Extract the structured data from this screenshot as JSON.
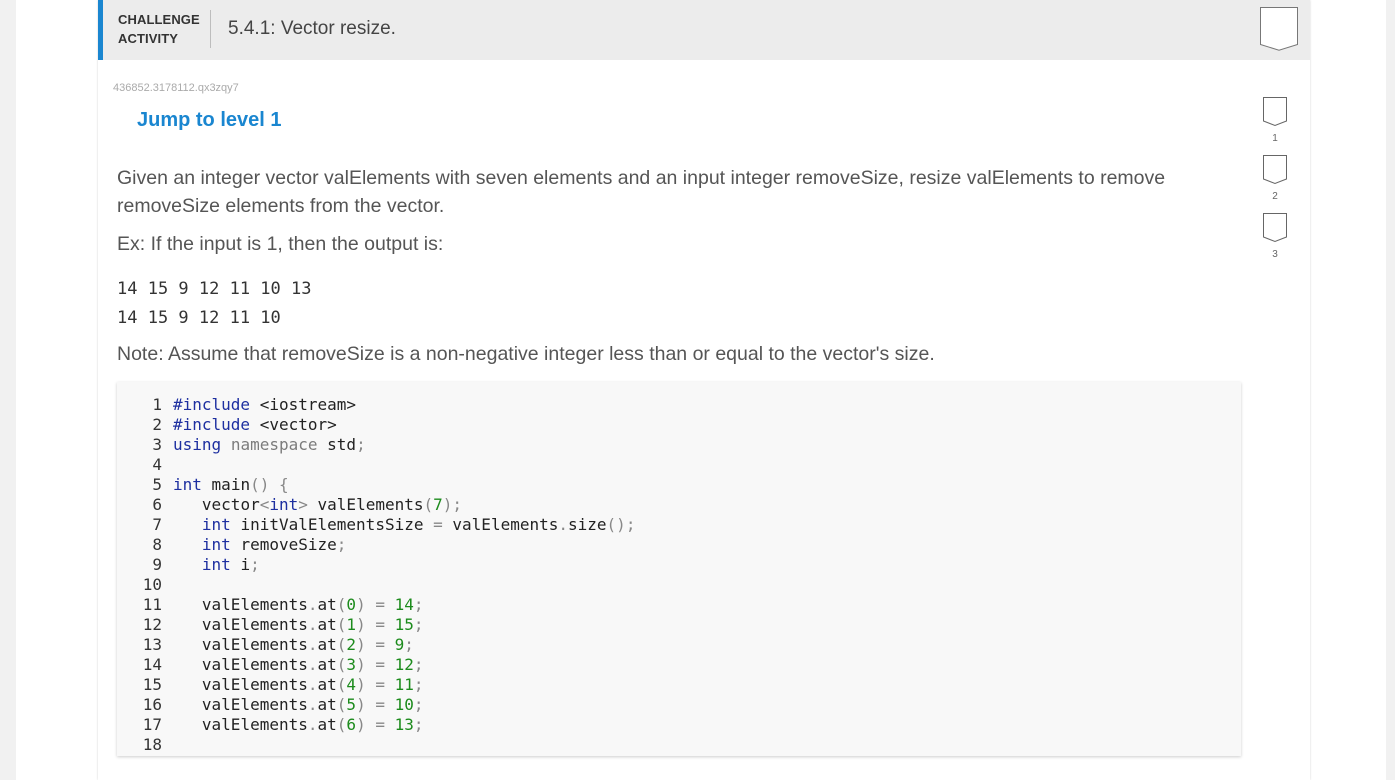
{
  "header": {
    "activity_type_line1": "CHALLENGE",
    "activity_type_line2": "ACTIVITY",
    "title": "5.4.1: Vector resize."
  },
  "challenge_id": "436852.3178112.qx3zqy7",
  "jump_link": "Jump to level 1",
  "prompt": "Given an integer vector valElements with seven elements and an input integer removeSize, resize valElements to remove removeSize elements from the vector.",
  "example_intro": "Ex: If the input is 1, then the output is:",
  "example_output": [
    "14 15 9 12 11 10 13",
    "14 15 9 12 11 10"
  ],
  "note": "Note: Assume that removeSize is a non-negative integer less than or equal to the vector's size.",
  "code": {
    "line_numbers": [
      "1",
      "2",
      "3",
      "4",
      "5",
      "6",
      "7",
      "8",
      "9",
      "10",
      "11",
      "12",
      "13",
      "14",
      "15",
      "16",
      "17",
      "18"
    ]
  },
  "levels": [
    {
      "number": "1"
    },
    {
      "number": "2"
    },
    {
      "number": "3"
    }
  ],
  "colors": {
    "accent": "#1a86d0",
    "keyword": "#1d2fa0",
    "number": "#1c8b1c"
  },
  "icons": {
    "bookmark": "bookmark-icon",
    "level": "level-badge-icon"
  }
}
